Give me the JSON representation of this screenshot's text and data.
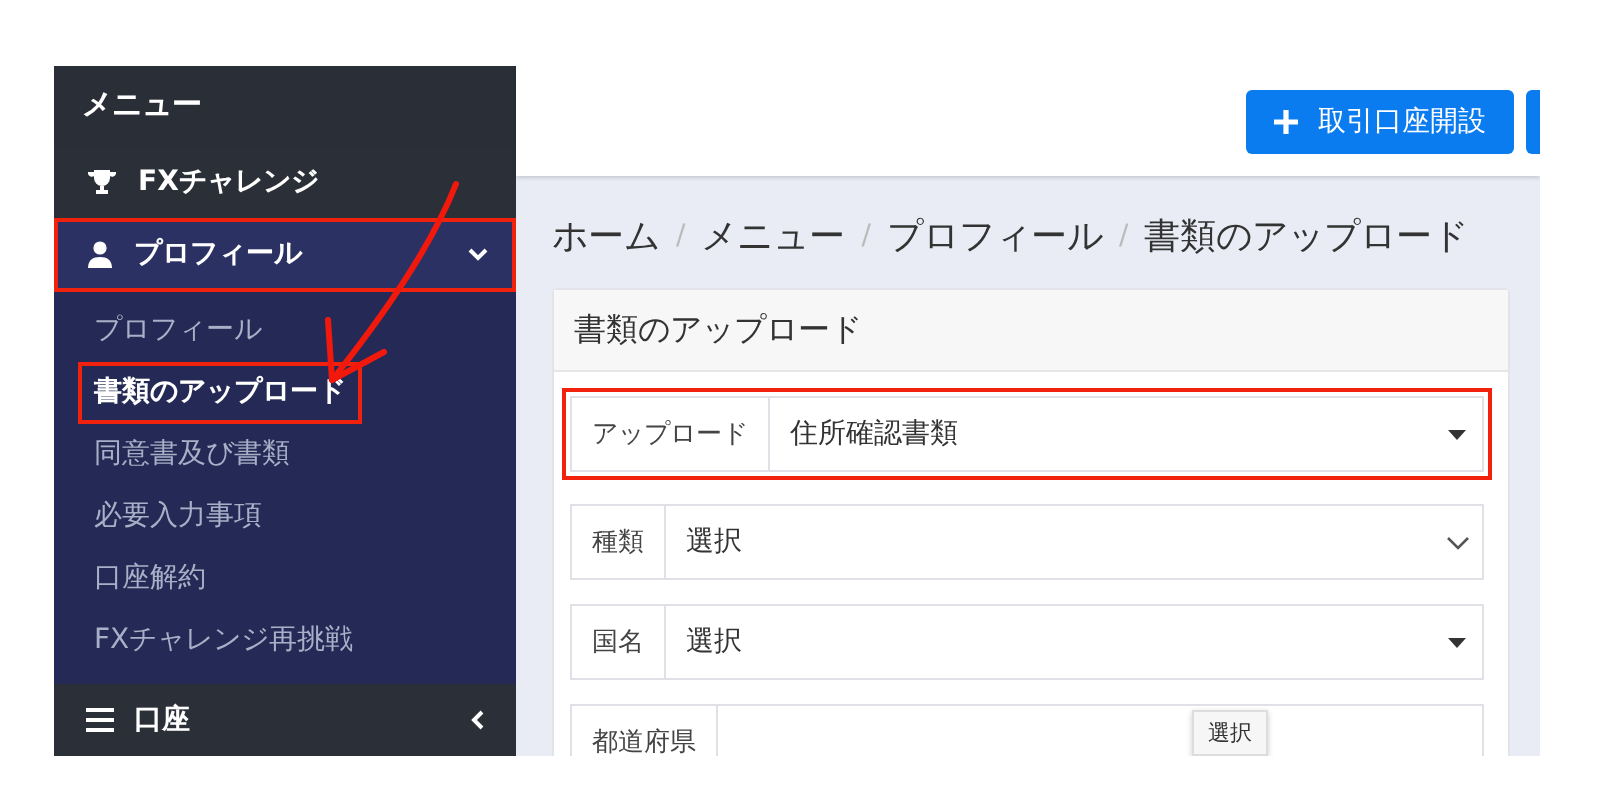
{
  "sidebar": {
    "title": "メニュー",
    "items": [
      {
        "label": "FXチャレンジ",
        "kind": "link",
        "expanded": false,
        "highlighted": false
      },
      {
        "label": "プロフィール",
        "kind": "group",
        "expanded": true,
        "highlighted": true,
        "children": [
          {
            "label": "プロフィール",
            "selected": false,
            "highlighted": false
          },
          {
            "label": "書類のアップロード",
            "selected": true,
            "highlighted": true
          },
          {
            "label": "同意書及び書類",
            "selected": false,
            "highlighted": false
          },
          {
            "label": "必要入力事項",
            "selected": false,
            "highlighted": false
          },
          {
            "label": "口座解約",
            "selected": false,
            "highlighted": false
          },
          {
            "label": "FXチャレンジ再挑戦",
            "selected": false,
            "highlighted": false
          }
        ]
      },
      {
        "label": "口座",
        "kind": "group",
        "expanded": false,
        "highlighted": false
      }
    ]
  },
  "header": {
    "buttons": [
      {
        "label": "取引口座開設"
      }
    ]
  },
  "breadcrumb": {
    "separator": "/",
    "items": [
      "ホーム",
      "メニュー",
      "プロフィール",
      "書類のアップロード"
    ]
  },
  "card": {
    "title": "書類のアップロード",
    "fields": [
      {
        "label": "アップロード",
        "value": "住所確認書類",
        "kind": "caret",
        "highlighted": true
      },
      {
        "label": "種類",
        "value": "選択",
        "kind": "chevron",
        "highlighted": false
      },
      {
        "label": "国名",
        "value": "選択",
        "kind": "caret",
        "highlighted": false
      },
      {
        "label": "都道府県",
        "kind": "text",
        "highlighted": false,
        "tooltip": "選択"
      }
    ]
  }
}
